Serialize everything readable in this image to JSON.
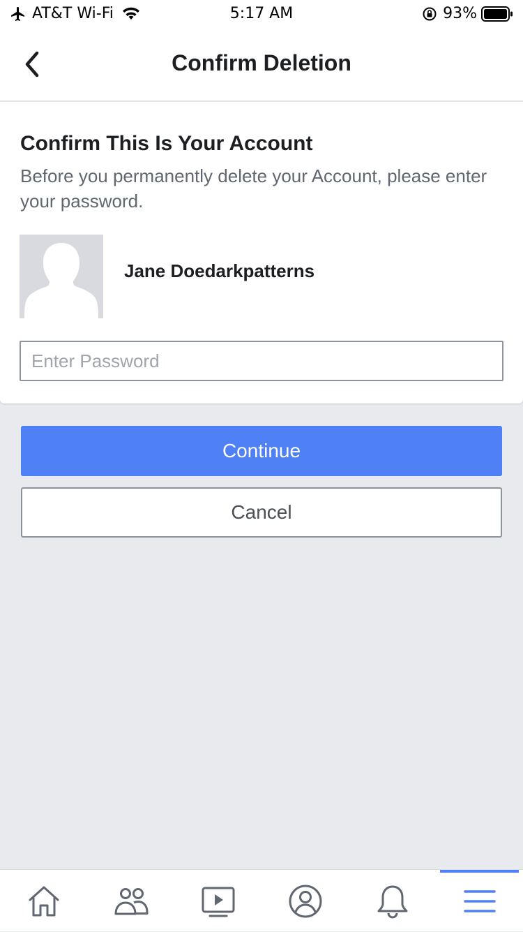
{
  "status_bar": {
    "carrier": "AT&T Wi-Fi",
    "time": "5:17 AM",
    "battery": "93%",
    "icons": [
      "airplane-icon",
      "wifi-icon",
      "orientation-lock-icon",
      "battery-icon"
    ]
  },
  "nav": {
    "title": "Confirm Deletion",
    "back_icon": "chevron-left-icon"
  },
  "card": {
    "heading": "Confirm This Is Your Account",
    "description": "Before you permanently delete your Account, please enter your password.",
    "user_name": "Jane Doedarkpatterns",
    "password_placeholder": "Enter Password",
    "password_value": ""
  },
  "buttons": {
    "continue_label": "Continue",
    "cancel_label": "Cancel"
  },
  "tab_bar": {
    "items": [
      "home-icon",
      "friends-icon",
      "watch-icon",
      "profile-icon",
      "notifications-icon",
      "menu-icon"
    ],
    "active": "menu-icon"
  },
  "colors": {
    "accent": "#4f80f5",
    "background": "#e9eaee",
    "icon_gray": "#606770"
  }
}
